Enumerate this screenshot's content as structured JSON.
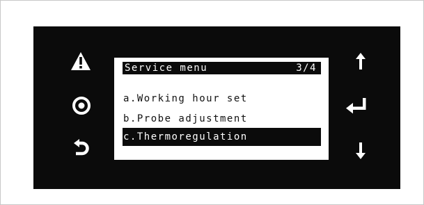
{
  "screen": {
    "title": "Service menu",
    "page_indicator": "3/4",
    "items": [
      {
        "label": "a.Working hour set",
        "selected": false
      },
      {
        "label": "b.Probe adjustment",
        "selected": false
      },
      {
        "label": "c.Thermoregulation",
        "selected": true
      }
    ]
  },
  "buttons": {
    "left": [
      "warning-icon",
      "ok-circle-icon",
      "back-arrow-icon"
    ],
    "right": [
      "arrow-up-icon",
      "enter-icon",
      "arrow-down-icon"
    ]
  },
  "colors": {
    "panel": "#0b0b0b",
    "display": "#ffffff",
    "highlight": "#0b0b0b",
    "icon": "#ffffff"
  }
}
